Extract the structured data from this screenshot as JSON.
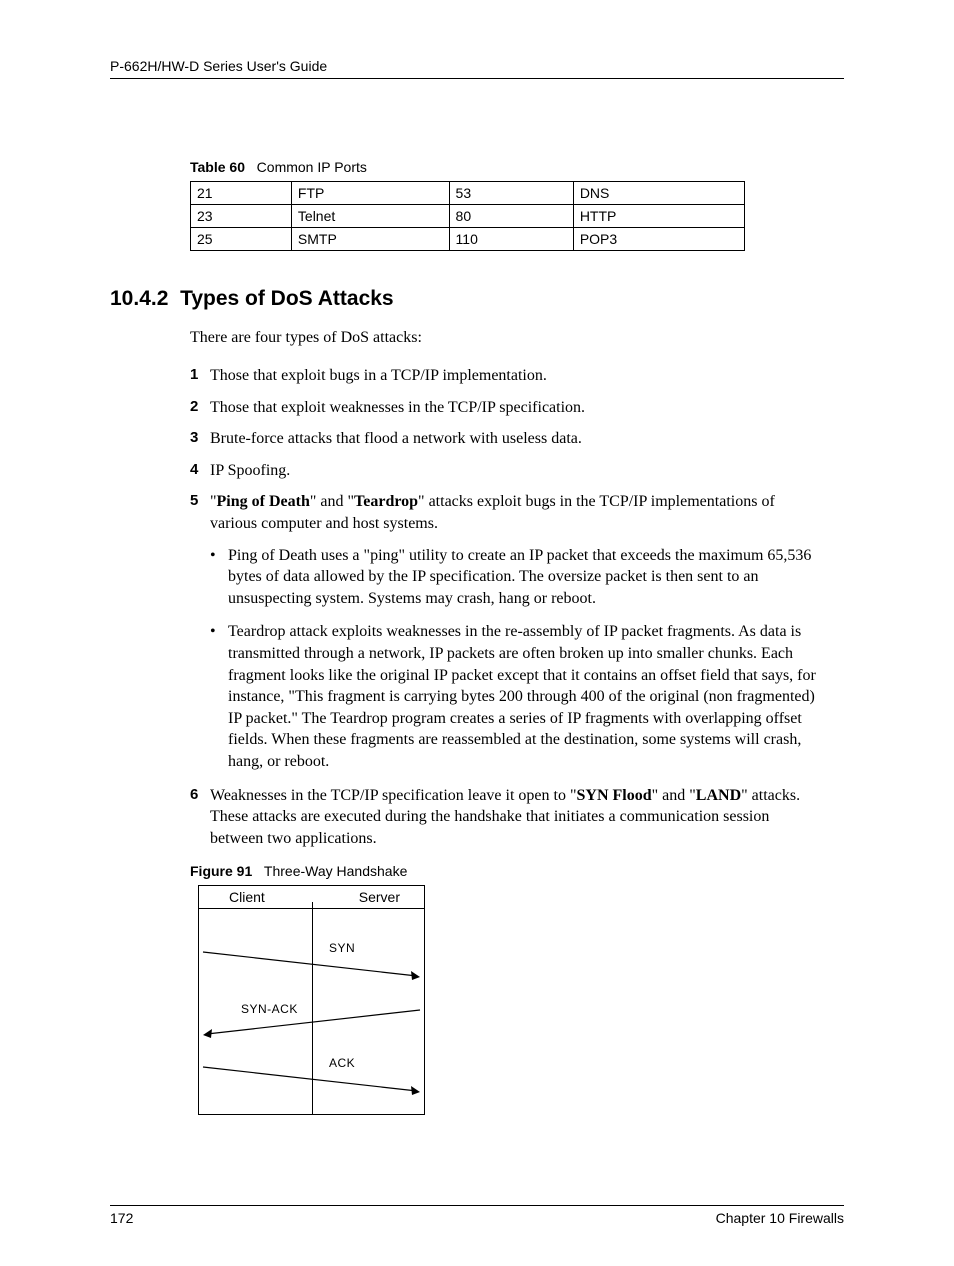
{
  "header": {
    "title": "P-662H/HW-D Series User's Guide"
  },
  "table": {
    "label": "Table 60",
    "caption": "Common IP Ports",
    "rows": [
      [
        "21",
        "FTP",
        "53",
        "DNS"
      ],
      [
        "23",
        "Telnet",
        "80",
        "HTTP"
      ],
      [
        "25",
        "SMTP",
        "110",
        "POP3"
      ]
    ]
  },
  "section": {
    "number": "10.4.2",
    "title": "Types of DoS Attacks",
    "intro": "There are four types of DoS attacks:",
    "items": [
      {
        "n": "1",
        "text": "Those that exploit bugs in a TCP/IP implementation."
      },
      {
        "n": "2",
        "text": "Those that exploit weaknesses in the TCP/IP specification."
      },
      {
        "n": "3",
        "text": "Brute-force attacks that flood a network with useless data."
      },
      {
        "n": "4",
        "text": "IP Spoofing."
      },
      {
        "n": "5",
        "pre": "\"",
        "b1": "Ping of Death",
        "mid": "\" and \"",
        "b2": "Teardrop",
        "post": "\" attacks exploit bugs in the TCP/IP implementations of various computer and host systems."
      },
      {
        "n": "6",
        "pre": "Weaknesses in the TCP/IP specification leave it open to \"",
        "b1": "SYN Flood",
        "mid": "\" and \"",
        "b2": "LAND",
        "post": "\" attacks. These attacks are executed during the handshake that initiates a communication session between two applications."
      }
    ],
    "bullets": [
      "Ping of Death uses a \"ping\" utility to create an IP packet that exceeds the maximum 65,536 bytes of data allowed by the IP specification. The oversize packet is then sent to an unsuspecting system. Systems may crash, hang or reboot.",
      "Teardrop attack exploits weaknesses in the re-assembly of IP packet fragments. As data is transmitted through a network, IP packets are often broken up into smaller chunks. Each fragment looks like the original IP packet except that it contains an offset field that says, for instance, \"This fragment is carrying bytes 200 through 400 of the original (non fragmented) IP packet.\" The Teardrop program creates a series of IP fragments with overlapping offset fields. When these fragments are reassembled at the destination, some systems will crash, hang, or reboot."
    ]
  },
  "figure": {
    "label": "Figure 91",
    "caption": "Three-Way Handshake",
    "client": "Client",
    "server": "Server",
    "msg1": "SYN",
    "msg2": "SYN-ACK",
    "msg3": "ACK"
  },
  "footer": {
    "page": "172",
    "chapter": "Chapter 10 Firewalls"
  }
}
